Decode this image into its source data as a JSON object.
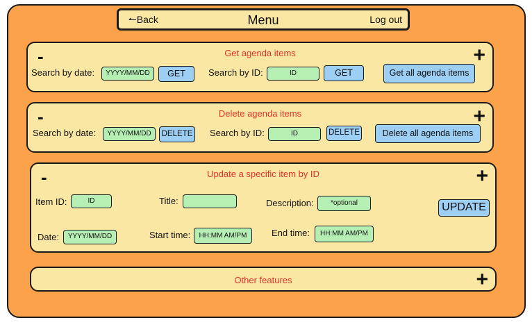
{
  "topbar": {
    "back_label": "Back",
    "title": "Menu",
    "logout_label": "Log out"
  },
  "get_panel": {
    "title": "Get agenda items",
    "minus": "-",
    "plus": "+",
    "date_label": "Search by date:",
    "date_placeholder": "YYYY/MM/DD",
    "get_date_button": "GET",
    "id_label": "Search by ID:",
    "id_placeholder": "ID",
    "get_id_button": "GET",
    "get_all_button": "Get all agenda items"
  },
  "delete_panel": {
    "title": "Delete agenda items",
    "minus": "-",
    "plus": "+",
    "date_label": "Search by date:",
    "date_placeholder": "YYYY/MM/DD",
    "delete_date_button": "DELETE",
    "id_label": "Search by ID:",
    "id_placeholder": "ID",
    "delete_id_button": "DELETE",
    "delete_all_button": "Delete all agenda items"
  },
  "update_panel": {
    "title": "Update a specific item by ID",
    "minus": "-",
    "plus": "+",
    "item_id_label": "Item ID:",
    "item_id_placeholder": "ID",
    "title_label": "Title:",
    "title_placeholder": "",
    "description_label": "Description:",
    "description_placeholder": "*optional",
    "update_button": "UPDATE",
    "date_label": "Date:",
    "date_placeholder": "YYYY/MM/DD",
    "start_label": "Start time:",
    "start_placeholder": "HH:MM AM/PM",
    "end_label": "End time:",
    "end_placeholder": "HH:MM AM/PM"
  },
  "other_panel": {
    "title": "Other features",
    "plus": "+"
  }
}
